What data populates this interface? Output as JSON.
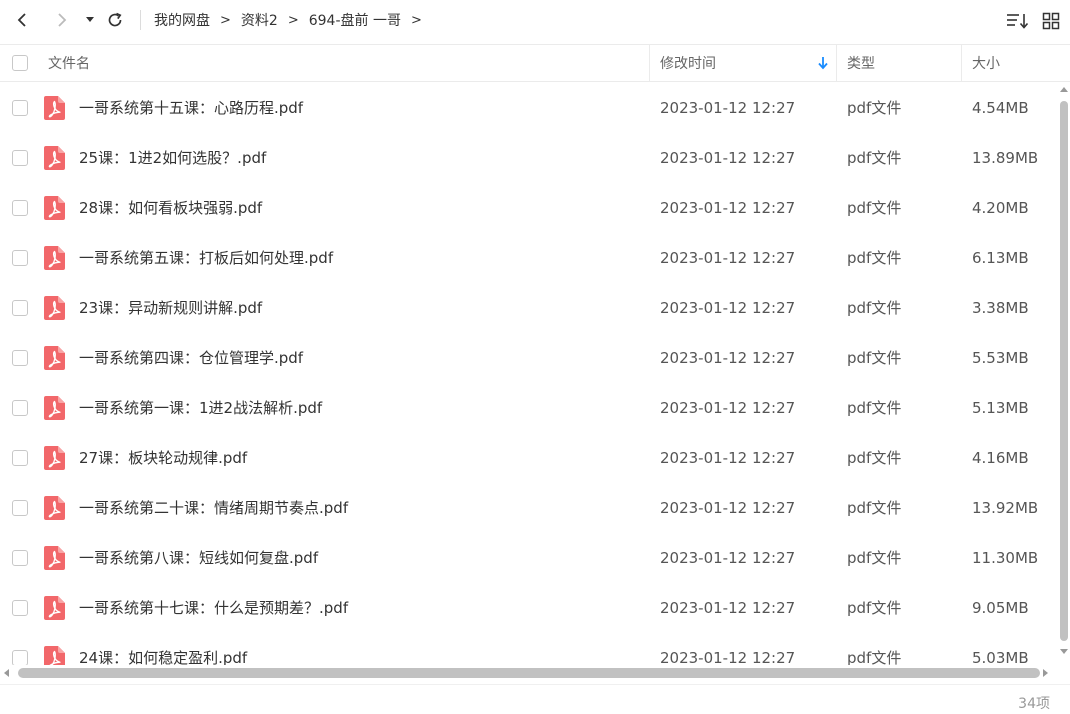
{
  "breadcrumb": [
    "我的网盘",
    "资料2",
    "694-盘前 一哥"
  ],
  "breadcrumb_separator": ">",
  "columns": {
    "name": "文件名",
    "modified": "修改时间",
    "type": "类型",
    "size": "大小"
  },
  "accent_color": "#1a8cff",
  "pdf_icon_color": "#f2676a",
  "files": [
    {
      "name": "一哥系统第十五课：心路历程.pdf",
      "modified": "2023-01-12 12:27",
      "type": "pdf文件",
      "size": "4.54MB"
    },
    {
      "name": "25课：1进2如何选股？.pdf",
      "modified": "2023-01-12 12:27",
      "type": "pdf文件",
      "size": "13.89MB"
    },
    {
      "name": "28课：如何看板块强弱.pdf",
      "modified": "2023-01-12 12:27",
      "type": "pdf文件",
      "size": "4.20MB"
    },
    {
      "name": "一哥系统第五课：打板后如何处理.pdf",
      "modified": "2023-01-12 12:27",
      "type": "pdf文件",
      "size": "6.13MB"
    },
    {
      "name": "23课：异动新规则讲解.pdf",
      "modified": "2023-01-12 12:27",
      "type": "pdf文件",
      "size": "3.38MB"
    },
    {
      "name": "一哥系统第四课：仓位管理学.pdf",
      "modified": "2023-01-12 12:27",
      "type": "pdf文件",
      "size": "5.53MB"
    },
    {
      "name": "一哥系统第一课：1进2战法解析.pdf",
      "modified": "2023-01-12 12:27",
      "type": "pdf文件",
      "size": "5.13MB"
    },
    {
      "name": "27课：板块轮动规律.pdf",
      "modified": "2023-01-12 12:27",
      "type": "pdf文件",
      "size": "4.16MB"
    },
    {
      "name": "一哥系统第二十课：情绪周期节奏点.pdf",
      "modified": "2023-01-12 12:27",
      "type": "pdf文件",
      "size": "13.92MB"
    },
    {
      "name": "一哥系统第八课：短线如何复盘.pdf",
      "modified": "2023-01-12 12:27",
      "type": "pdf文件",
      "size": "11.30MB"
    },
    {
      "name": "一哥系统第十七课：什么是预期差？.pdf",
      "modified": "2023-01-12 12:27",
      "type": "pdf文件",
      "size": "9.05MB"
    },
    {
      "name": "24课：如何稳定盈利.pdf",
      "modified": "2023-01-12 12:27",
      "type": "pdf文件",
      "size": "5.03MB"
    }
  ],
  "footer": {
    "count": "34项"
  },
  "icons": {
    "back": "chevron-left-icon",
    "forward": "chevron-right-icon",
    "dropdown": "caret-down-icon",
    "refresh": "refresh-icon",
    "sort": "sort-icon",
    "grid": "grid-view-icon",
    "sort_direction": "arrow-down-icon",
    "file": "pdf-file-icon"
  }
}
